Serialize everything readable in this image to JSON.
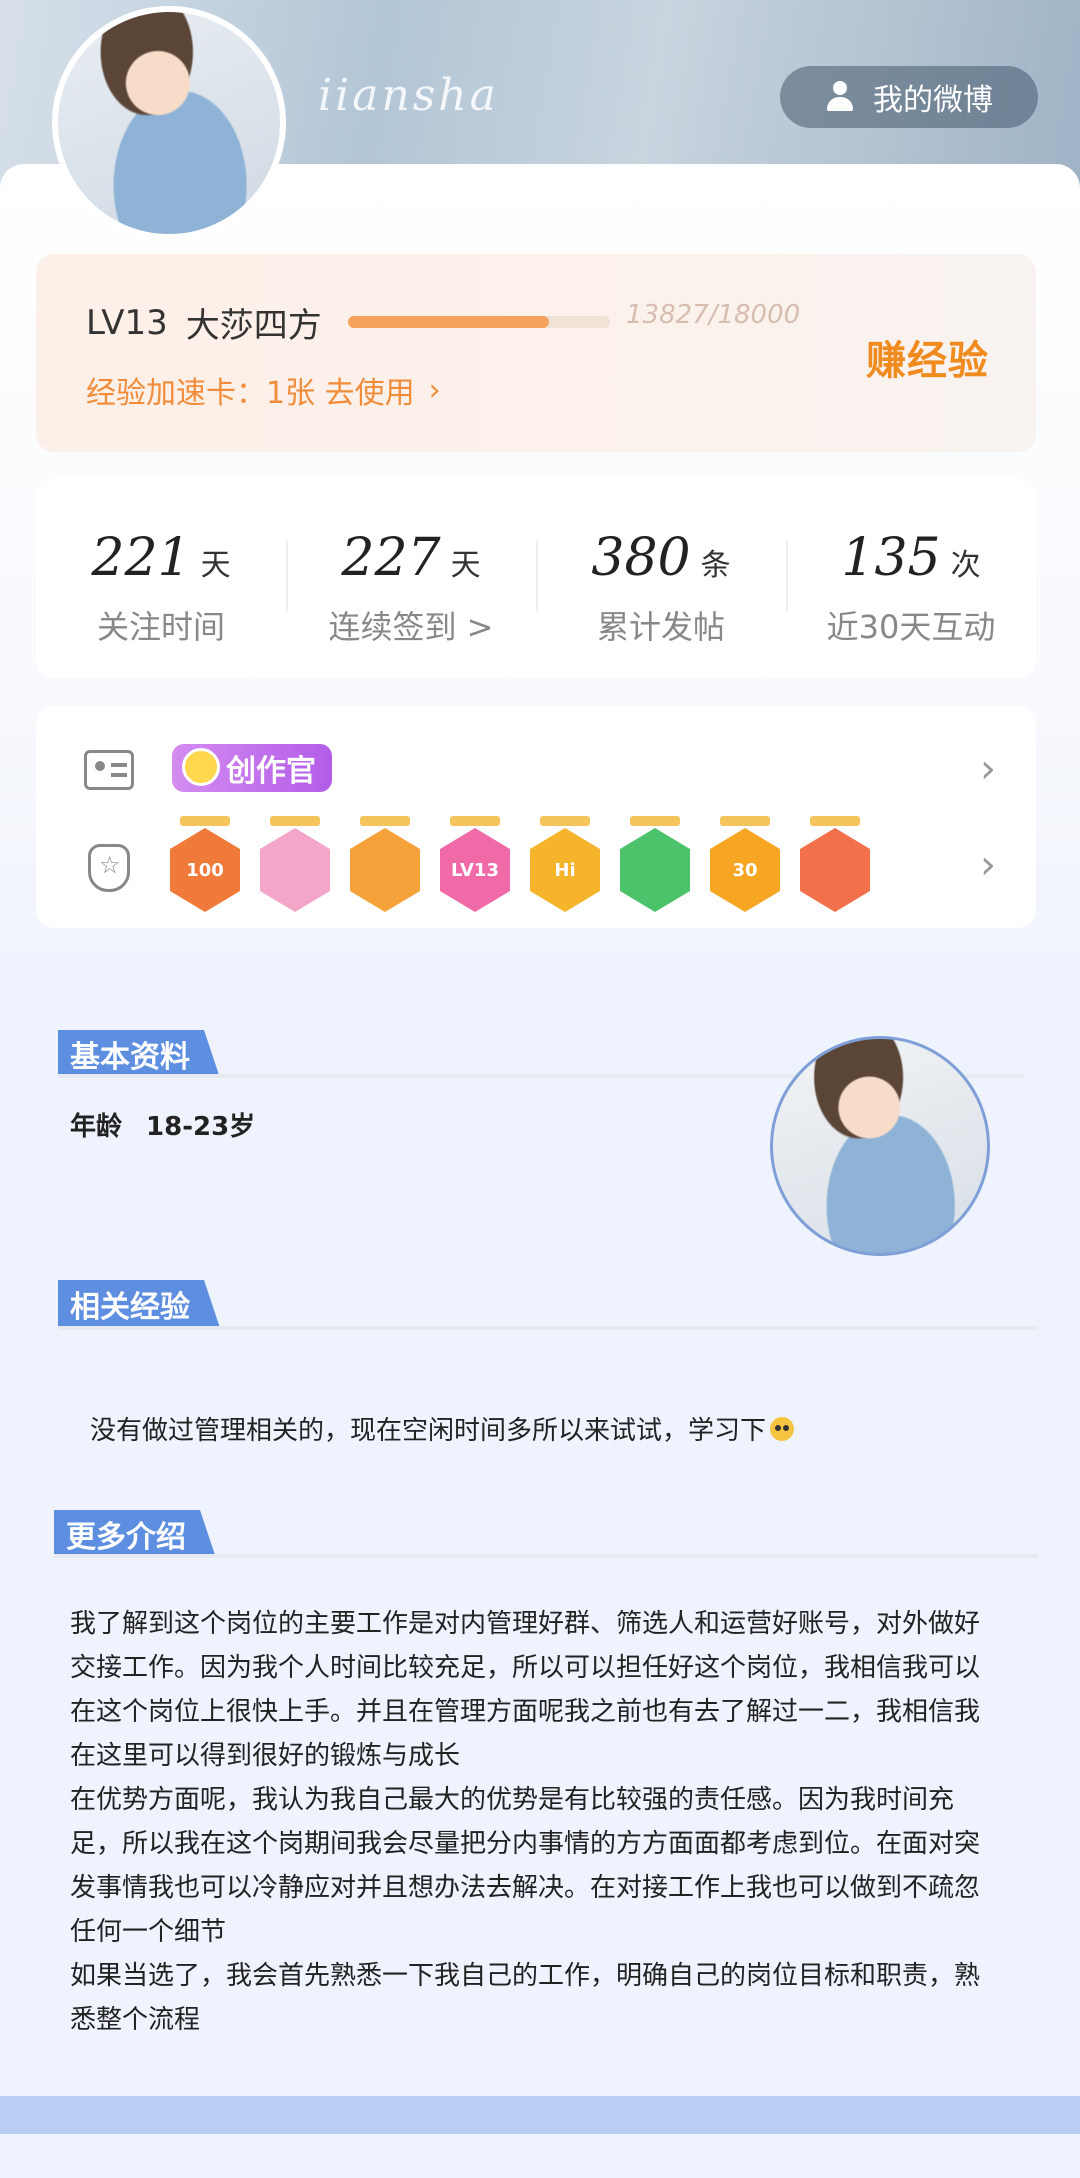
{
  "header": {
    "username": "iiansha",
    "weibo_button": "我的微博"
  },
  "level": {
    "level": "LV13",
    "name": "大莎四方",
    "progress_text": "13827/18000",
    "progress": 0.768,
    "speed_card_text": "经验加速卡：1张 去使用",
    "earn_exp": "赚经验"
  },
  "stats": [
    {
      "value": "221",
      "unit": "天",
      "label": "关注时间"
    },
    {
      "value": "227",
      "unit": "天",
      "label": "连续签到 >"
    },
    {
      "value": "380",
      "unit": "条",
      "label": "累计发帖"
    },
    {
      "value": "135",
      "unit": "次",
      "label": "近30天互动"
    }
  ],
  "badges": {
    "creator": "创作官",
    "medals": [
      {
        "text": "100",
        "color": "#f07a3a"
      },
      {
        "text": "",
        "color": "#f3a6c8"
      },
      {
        "text": "",
        "color": "#f6a23a"
      },
      {
        "text": "LV13",
        "color": "#f06aa8"
      },
      {
        "text": "Hi",
        "color": "#f6b42c"
      },
      {
        "text": "",
        "color": "#4cc36a"
      },
      {
        "text": "30",
        "color": "#f6a623"
      },
      {
        "text": "",
        "color": "#f2704a"
      }
    ]
  },
  "basic_info": {
    "title": "基本资料",
    "age_label": "年龄",
    "age_value": "18-23岁"
  },
  "experience": {
    "title": "相关经验",
    "text": "没有做过管理相关的，现在空闲时间多所以来试试，学习下"
  },
  "more_intro": {
    "title": "更多介绍",
    "paragraphs": [
      "我了解到这个岗位的主要工作是对内管理好群、筛选人和运营好账号，对外做好交接工作。因为我个人时间比较充足，所以可以担任好这个岗位，我相信我可以在这个岗位上很快上手。并且在管理方面呢我之前也有去了解过一二，我相信我在这里可以得到很好的锻炼与成长",
      "在优势方面呢，我认为我自己最大的优势是有比较强的责任感。因为我时间充足，所以我在这个岗期间我会尽量把分内事情的方方面面都考虑到位。在面对突发事情我也可以冷静应对并且想办法去解决。在对接工作上我也可以做到不疏忽任何一个细节",
      "如果当选了，我会首先熟悉一下我自己的工作，明确自己的岗位目标和职责，熟悉整个流程"
    ]
  },
  "colors": {
    "accent_blue": "#5d8ee0",
    "accent_orange": "#f08c3a"
  }
}
